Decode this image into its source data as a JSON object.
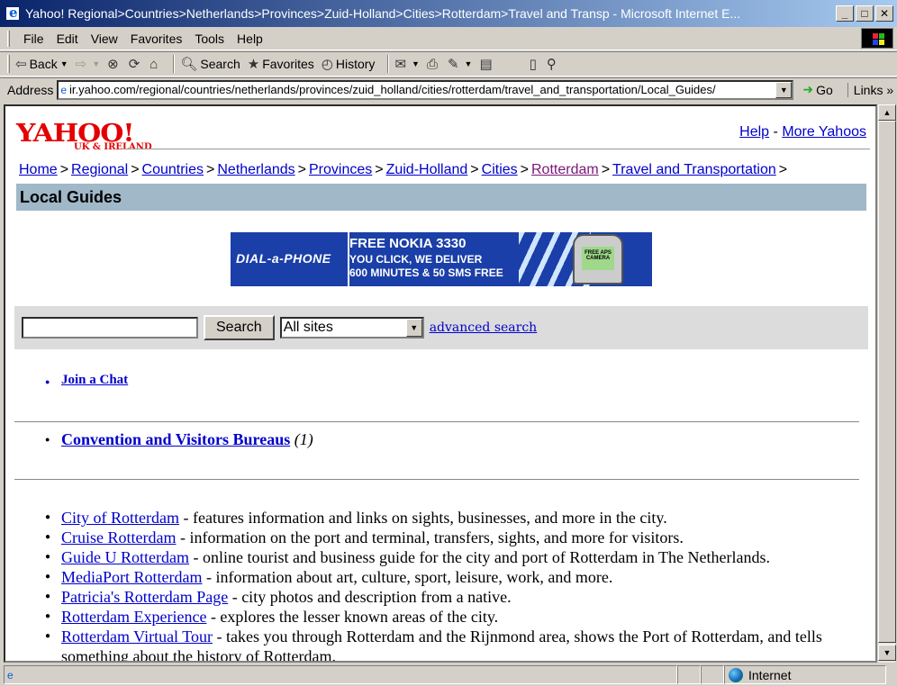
{
  "window": {
    "title": "Yahoo! Regional>Countries>Netherlands>Provinces>Zuid-Holland>Cities>Rotterdam>Travel and Transp - Microsoft Internet E...",
    "min_label": "_",
    "max_label": "□",
    "close_label": "✕"
  },
  "menu": {
    "items": [
      "File",
      "Edit",
      "View",
      "Favorites",
      "Tools",
      "Help"
    ]
  },
  "toolbar": {
    "back_label": "Back",
    "search_label": "Search",
    "favorites_label": "Favorites",
    "history_label": "History"
  },
  "address": {
    "label": "Address",
    "url": "ir.yahoo.com/regional/countries/netherlands/provinces/zuid_holland/cities/rotterdam/travel_and_transportation/Local_Guides/",
    "go_label": "Go",
    "links_label": "Links"
  },
  "page": {
    "logo_main": "YAHOO!",
    "logo_sub": "UK & IRELAND",
    "help_link": "Help",
    "more_link": "More Yahoos",
    "breadcrumbs": [
      "Home",
      "Regional",
      "Countries",
      "Netherlands",
      "Provinces",
      "Zuid-Holland",
      "Cities",
      "Rotterdam",
      "Travel and Transportation"
    ],
    "section_title": "Local Guides",
    "banner": {
      "brand": "DIAL-a-PHONE",
      "line1": "FREE NOKIA 3330",
      "line2": "YOU CLICK, WE DELIVER",
      "line3": "600 MINUTES & 50 SMS FREE",
      "phone_text": "FREE APS CAMERA"
    },
    "search": {
      "button_label": "Search",
      "scope_value": "All sites",
      "advanced_label": "advanced search"
    },
    "chat_link": "Join a Chat",
    "category": {
      "name": "Convention and Visitors Bureaus",
      "count": "(1)"
    },
    "sites": [
      {
        "name": "City of Rotterdam",
        "desc": " - features information and links on sights, businesses, and more in the city."
      },
      {
        "name": "Cruise Rotterdam",
        "desc": " - information on the port and terminal, transfers, sights, and more for visitors."
      },
      {
        "name": "Guide U Rotterdam",
        "desc": " - online tourist and business guide for the city and port of Rotterdam in The Netherlands."
      },
      {
        "name": "MediaPort Rotterdam",
        "desc": " - information about art, culture, sport, leisure, work, and more."
      },
      {
        "name": "Patricia's Rotterdam Page",
        "desc": " - city photos and description from a native."
      },
      {
        "name": "Rotterdam Experience",
        "desc": " - explores the lesser known areas of the city."
      },
      {
        "name": "Rotterdam Virtual Tour",
        "desc": " - takes you through Rotterdam and the Rijnmond area, shows the Port of Rotterdam, and tells something about the history of Rotterdam."
      }
    ]
  },
  "status": {
    "zone": "Internet"
  }
}
